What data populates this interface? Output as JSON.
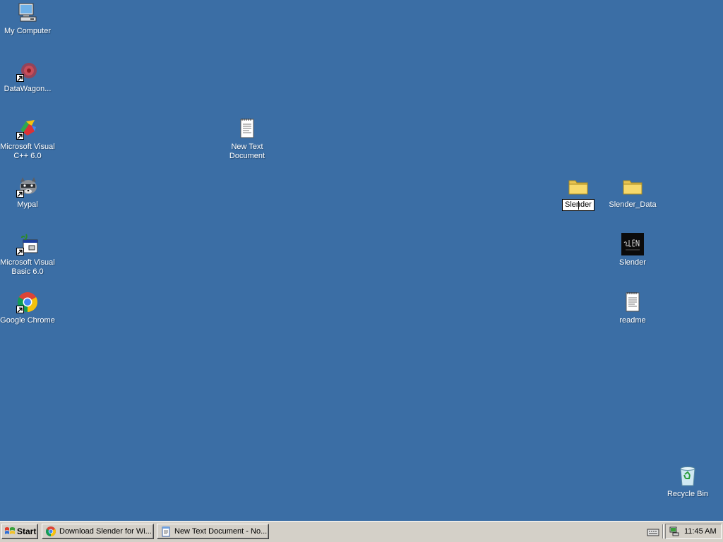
{
  "desktop": {
    "background": "#3b6ea5",
    "icons": {
      "my_computer": "My Computer",
      "datawagon": "DataWagon...",
      "msvcpp": "Microsoft Visual\nC++ 6.0",
      "mypal": "Mypal",
      "msvb": "Microsoft Visual\nBasic 6.0",
      "chrome": "Google Chrome",
      "new_text_doc": "New Text\nDocument",
      "slender_folder_rename": "Slender",
      "slender_data": "Slender_Data",
      "slender_exe": "Slender",
      "readme": "readme",
      "recycle_bin": "Recycle Bin"
    }
  },
  "taskbar": {
    "start_label": "Start",
    "tasks": [
      {
        "label": "Download Slender for Wi...",
        "icon": "chrome-icon"
      },
      {
        "label": "New Text Document - No...",
        "icon": "notepad-icon"
      }
    ],
    "clock": "11:45 AM"
  }
}
